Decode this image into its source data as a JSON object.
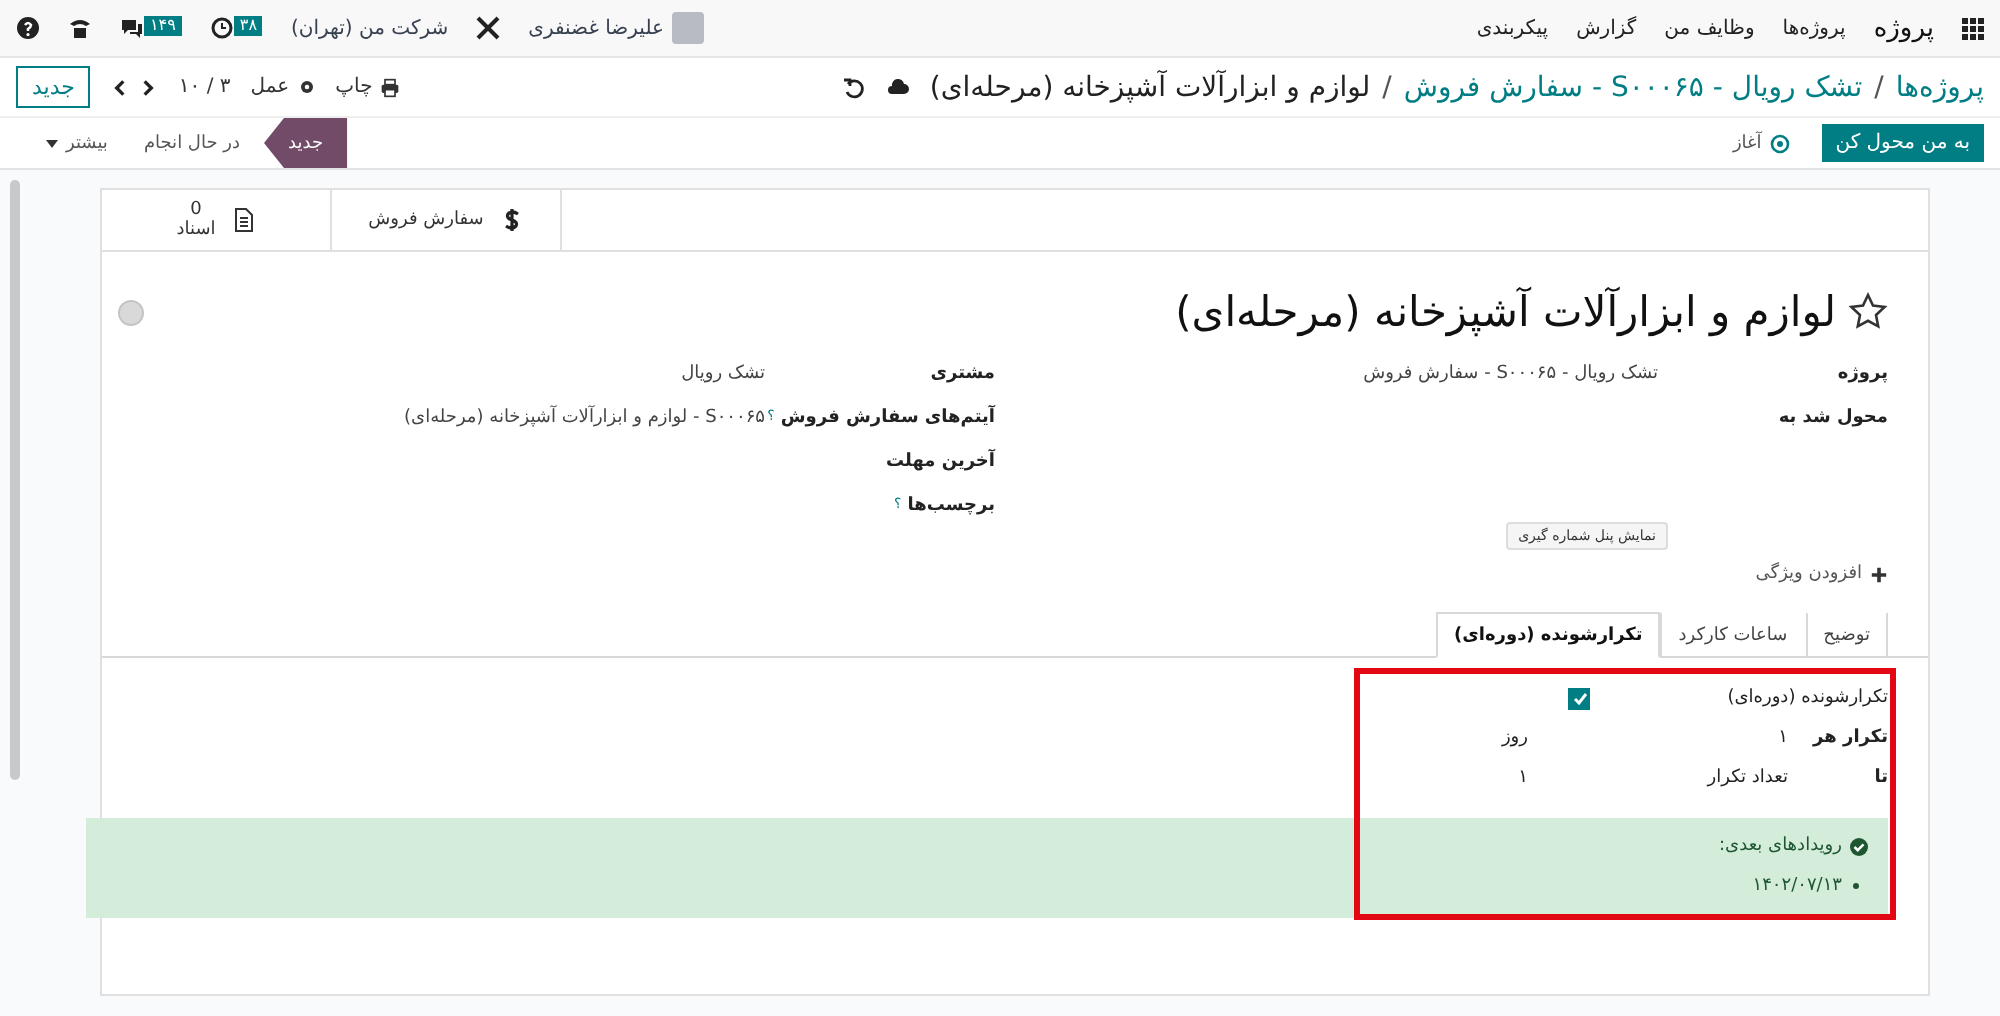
{
  "navbar": {
    "app": "پروژه",
    "menu": [
      "پروژه‌ها",
      "وظایف من",
      "گزارش",
      "پیکربندی"
    ],
    "messages_badge": "۱۴۹",
    "activities_badge": "۳۸",
    "company": "شرکت من (تهران)",
    "user": "علیرضا غضنفری"
  },
  "breadcrumb_separator": "/",
  "breadcrumbs": [
    "پروژه‌ها",
    "تشک رویال - S۰۰۰۶۵ - سفارش فروش",
    "لوازم و ابزارآلات آشپزخانه (مرحله‌ای)"
  ],
  "toolbar": {
    "print": "چاپ",
    "action": "عمل",
    "pager": "۳ / ۱۰",
    "new": "جدید"
  },
  "status_actions": [
    {
      "kind": "primary",
      "label": "به من محول کن"
    },
    {
      "kind": "link",
      "label": "آغاز"
    }
  ],
  "stages": [
    {
      "label": "جدید",
      "selected": true
    },
    {
      "label": "در حال انجام",
      "selected": false
    }
  ],
  "more": "بیشتر",
  "stat_buttons": [
    {
      "kind": "sale",
      "label": "سفارش فروش"
    },
    {
      "kind": "docs",
      "value": "0",
      "label": "اسناد"
    }
  ],
  "title": "لوازم و ابزارآلات آشپزخانه (مرحله‌ای)",
  "fields_right": [
    {
      "label": "پروژه",
      "value": "تشک رویال - S۰۰۰۶۵ - سفارش فروش"
    },
    {
      "label": "محول شد به"
    }
  ],
  "fields_left": [
    {
      "label": "مشتری",
      "value": "تشک رویال"
    },
    {
      "label": "آیتم‌های سفارش فروش",
      "help": "؟",
      "value": "S۰۰۰۶۵ - لوازم و ابزارآلات آشپزخانه (مرحله‌ای)"
    },
    {
      "label": "آخرین مهلت"
    },
    {
      "label": "برچسب‌ها",
      "help": "؟"
    }
  ],
  "tooltip": "نمایش پنل شماره گیری",
  "add_property": "افزودن ویژگی",
  "tabs": [
    {
      "label": "توضیح",
      "selected": false
    },
    {
      "label": "ساعات کارکرد",
      "selected": false
    },
    {
      "label": "تکرارشونده (دوره‌ای)",
      "selected": true
    }
  ],
  "recurrence": {
    "label": "تکرارشونده (دوره‌ای)",
    "checked": true,
    "repeat_label": "تکرار هر",
    "repeat_value": "۱",
    "repeat_unit": "روز",
    "until_label": "تا",
    "until_mode": "تعداد تکرار",
    "count": "۱"
  },
  "next_events": {
    "title": "رویدادهای بعدی:",
    "dates": [
      "۱۴۰۲/۰۷/۱۳"
    ]
  }
}
